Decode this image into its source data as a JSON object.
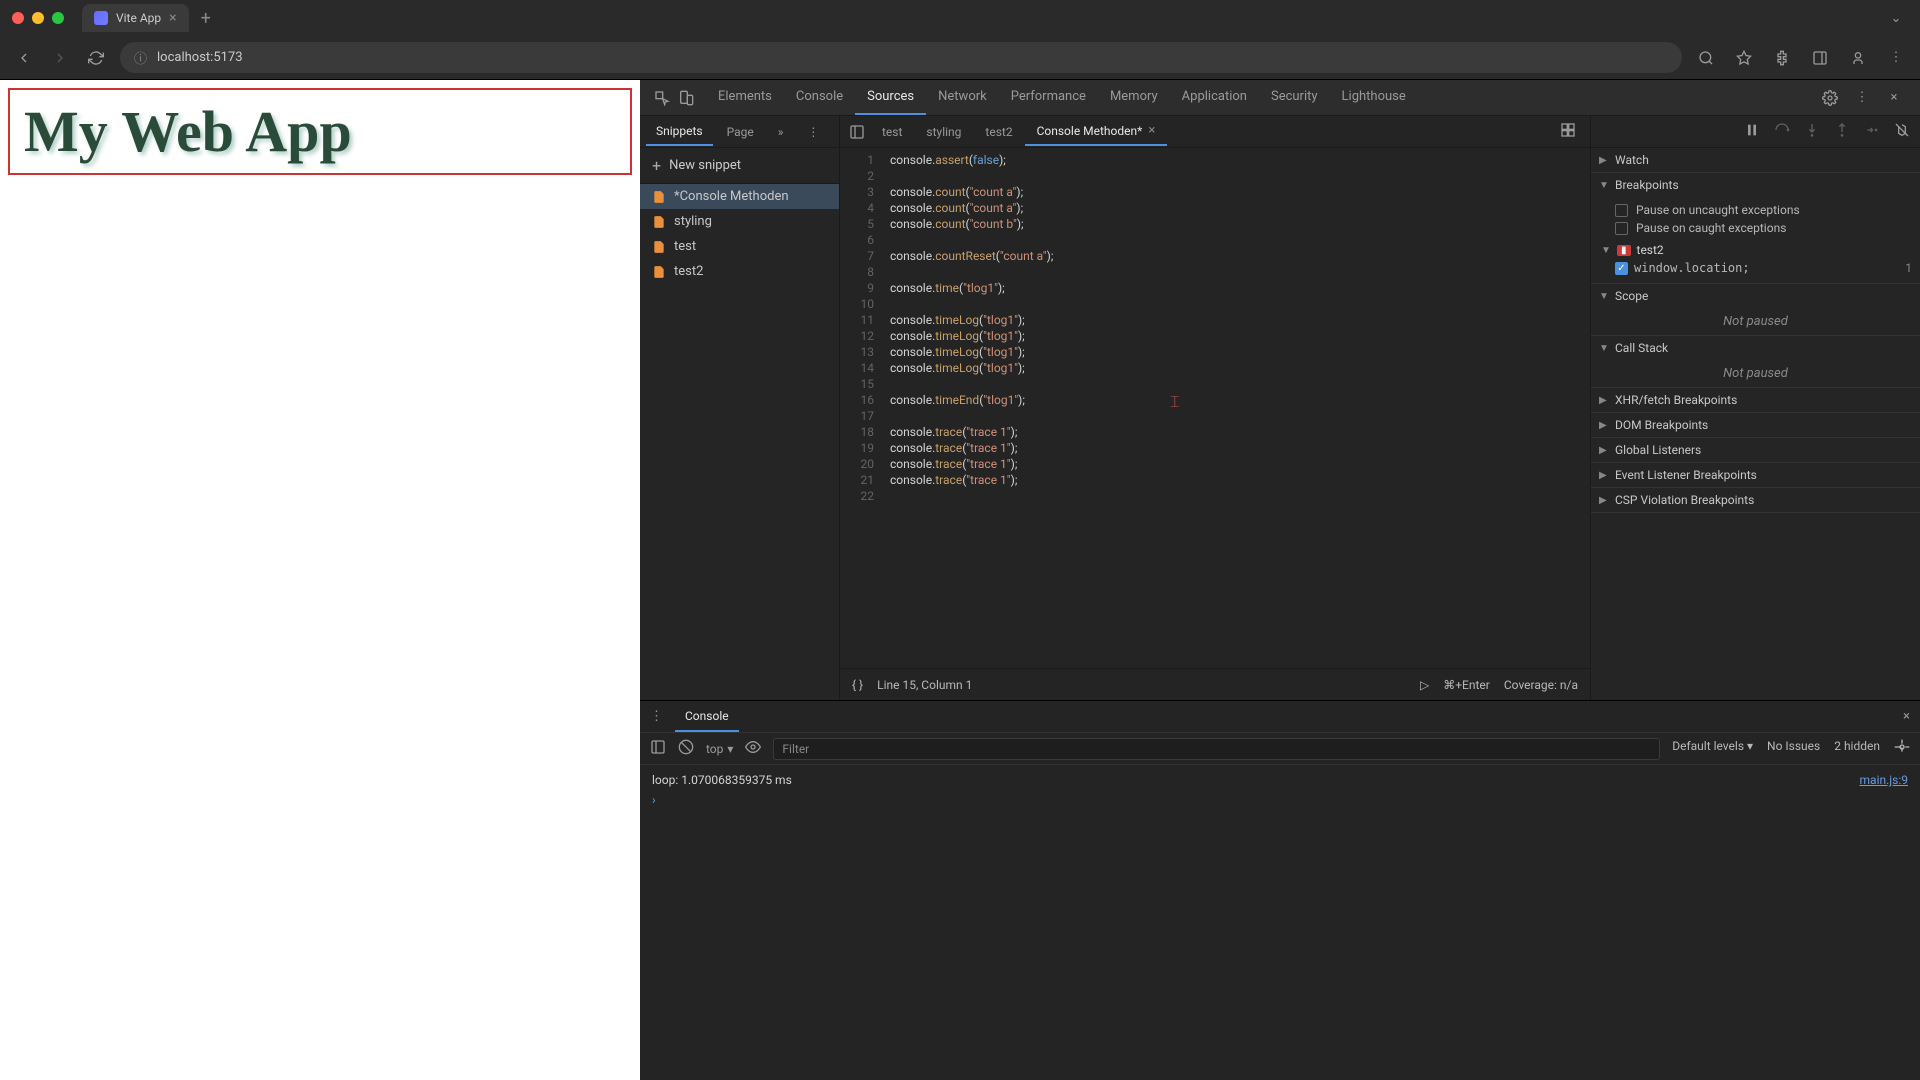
{
  "browser": {
    "tab_title": "Vite App",
    "url": "localhost:5173"
  },
  "page": {
    "heading": "My Web App"
  },
  "devtools": {
    "tabs": [
      "Elements",
      "Console",
      "Sources",
      "Network",
      "Performance",
      "Memory",
      "Application",
      "Security",
      "Lighthouse"
    ],
    "active_tab": "Sources"
  },
  "sources": {
    "subtabs": [
      "Snippets",
      "Page"
    ],
    "active_subtab": "Snippets",
    "new_snippet_label": "New snippet",
    "snippets": [
      {
        "name": "*Console Methoden",
        "selected": true
      },
      {
        "name": "styling",
        "selected": false
      },
      {
        "name": "test",
        "selected": false
      },
      {
        "name": "test2",
        "selected": false
      }
    ],
    "editor_tabs": [
      {
        "name": "test",
        "active": false,
        "modified": false
      },
      {
        "name": "styling",
        "active": false,
        "modified": false
      },
      {
        "name": "test2",
        "active": false,
        "modified": false
      },
      {
        "name": "Console Methoden*",
        "active": true,
        "modified": true
      }
    ],
    "code_lines": [
      [
        {
          "t": "obj",
          "v": "console"
        },
        {
          "t": "p",
          "v": "."
        },
        {
          "t": "method",
          "v": "assert"
        },
        {
          "t": "p",
          "v": "("
        },
        {
          "t": "bool",
          "v": "false"
        },
        {
          "t": "p",
          "v": ");"
        }
      ],
      [],
      [
        {
          "t": "obj",
          "v": "console"
        },
        {
          "t": "p",
          "v": "."
        },
        {
          "t": "method",
          "v": "count"
        },
        {
          "t": "p",
          "v": "("
        },
        {
          "t": "str",
          "v": "\"count a\""
        },
        {
          "t": "p",
          "v": ");"
        }
      ],
      [
        {
          "t": "obj",
          "v": "console"
        },
        {
          "t": "p",
          "v": "."
        },
        {
          "t": "method",
          "v": "count"
        },
        {
          "t": "p",
          "v": "("
        },
        {
          "t": "str",
          "v": "\"count a\""
        },
        {
          "t": "p",
          "v": ");"
        }
      ],
      [
        {
          "t": "obj",
          "v": "console"
        },
        {
          "t": "p",
          "v": "."
        },
        {
          "t": "method",
          "v": "count"
        },
        {
          "t": "p",
          "v": "("
        },
        {
          "t": "str",
          "v": "\"count b\""
        },
        {
          "t": "p",
          "v": ");"
        }
      ],
      [],
      [
        {
          "t": "obj",
          "v": "console"
        },
        {
          "t": "p",
          "v": "."
        },
        {
          "t": "method",
          "v": "countReset"
        },
        {
          "t": "p",
          "v": "("
        },
        {
          "t": "str",
          "v": "\"count a\""
        },
        {
          "t": "p",
          "v": ");"
        }
      ],
      [],
      [
        {
          "t": "obj",
          "v": "console"
        },
        {
          "t": "p",
          "v": "."
        },
        {
          "t": "method",
          "v": "time"
        },
        {
          "t": "p",
          "v": "("
        },
        {
          "t": "str",
          "v": "\"tlog1\""
        },
        {
          "t": "p",
          "v": ");"
        }
      ],
      [],
      [
        {
          "t": "obj",
          "v": "console"
        },
        {
          "t": "p",
          "v": "."
        },
        {
          "t": "method",
          "v": "timeLog"
        },
        {
          "t": "p",
          "v": "("
        },
        {
          "t": "str",
          "v": "\"tlog1\""
        },
        {
          "t": "p",
          "v": ");"
        }
      ],
      [
        {
          "t": "obj",
          "v": "console"
        },
        {
          "t": "p",
          "v": "."
        },
        {
          "t": "method",
          "v": "timeLog"
        },
        {
          "t": "p",
          "v": "("
        },
        {
          "t": "str",
          "v": "\"tlog1\""
        },
        {
          "t": "p",
          "v": ");"
        }
      ],
      [
        {
          "t": "obj",
          "v": "console"
        },
        {
          "t": "p",
          "v": "."
        },
        {
          "t": "method",
          "v": "timeLog"
        },
        {
          "t": "p",
          "v": "("
        },
        {
          "t": "str",
          "v": "\"tlog1\""
        },
        {
          "t": "p",
          "v": ");"
        }
      ],
      [
        {
          "t": "obj",
          "v": "console"
        },
        {
          "t": "p",
          "v": "."
        },
        {
          "t": "method",
          "v": "timeLog"
        },
        {
          "t": "p",
          "v": "("
        },
        {
          "t": "str",
          "v": "\"tlog1\""
        },
        {
          "t": "p",
          "v": ");"
        }
      ],
      [],
      [
        {
          "t": "obj",
          "v": "console"
        },
        {
          "t": "p",
          "v": "."
        },
        {
          "t": "method",
          "v": "timeEnd"
        },
        {
          "t": "p",
          "v": "("
        },
        {
          "t": "str",
          "v": "\"tlog1\""
        },
        {
          "t": "p",
          "v": ");"
        }
      ],
      [],
      [
        {
          "t": "obj",
          "v": "console"
        },
        {
          "t": "p",
          "v": "."
        },
        {
          "t": "method",
          "v": "trace"
        },
        {
          "t": "p",
          "v": "("
        },
        {
          "t": "str",
          "v": "\"trace 1\""
        },
        {
          "t": "p",
          "v": ");"
        }
      ],
      [
        {
          "t": "obj",
          "v": "console"
        },
        {
          "t": "p",
          "v": "."
        },
        {
          "t": "method",
          "v": "trace"
        },
        {
          "t": "p",
          "v": "("
        },
        {
          "t": "str",
          "v": "\"trace 1\""
        },
        {
          "t": "p",
          "v": ");"
        }
      ],
      [
        {
          "t": "obj",
          "v": "console"
        },
        {
          "t": "p",
          "v": "."
        },
        {
          "t": "method",
          "v": "trace"
        },
        {
          "t": "p",
          "v": "("
        },
        {
          "t": "str",
          "v": "\"trace 1\""
        },
        {
          "t": "p",
          "v": ");"
        }
      ],
      [
        {
          "t": "obj",
          "v": "console"
        },
        {
          "t": "p",
          "v": "."
        },
        {
          "t": "method",
          "v": "trace"
        },
        {
          "t": "p",
          "v": "("
        },
        {
          "t": "str",
          "v": "\"trace 1\""
        },
        {
          "t": "p",
          "v": ");"
        }
      ],
      []
    ],
    "status_position": "Line 15, Column 1",
    "status_shortcut": "⌘+Enter",
    "status_coverage": "Coverage: n/a"
  },
  "debugger": {
    "sections": {
      "watch": "Watch",
      "breakpoints": "Breakpoints",
      "scope": "Scope",
      "call_stack": "Call Stack",
      "xhr": "XHR/fetch Breakpoints",
      "dom": "DOM Breakpoints",
      "global": "Global Listeners",
      "event": "Event Listener Breakpoints",
      "csp": "CSP Violation Breakpoints"
    },
    "pause_uncaught": "Pause on uncaught exceptions",
    "pause_caught": "Pause on caught exceptions",
    "bp_group": "test2",
    "bp_code": "window.location;",
    "bp_line": "1",
    "not_paused": "Not paused"
  },
  "console": {
    "tab_label": "Console",
    "context": "top",
    "filter_placeholder": "Filter",
    "levels": "Default levels",
    "issues": "No Issues",
    "hidden": "2 hidden",
    "message": "loop: 1.070068359375 ms",
    "message_src": "main.js:9"
  }
}
